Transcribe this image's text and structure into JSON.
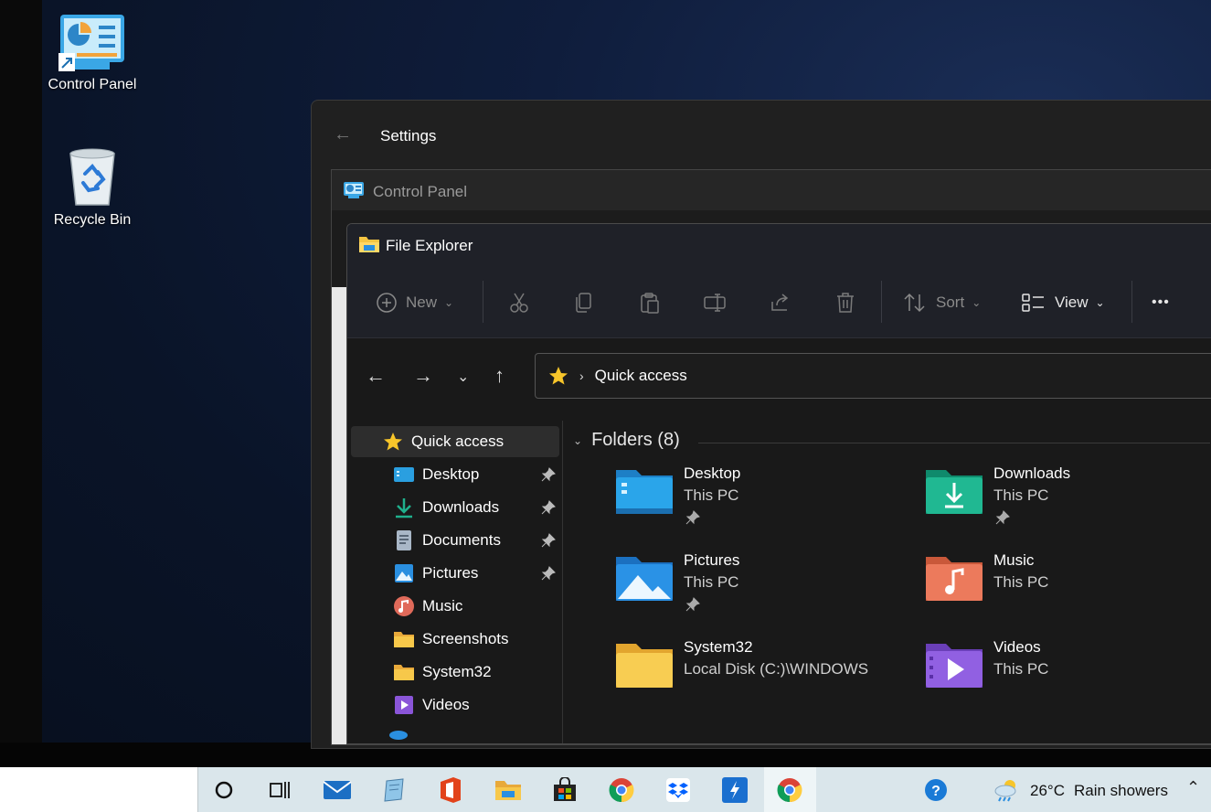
{
  "desktop": {
    "icons": [
      {
        "label": "Control Panel"
      },
      {
        "label": "Recycle Bin"
      }
    ]
  },
  "settings": {
    "title": "Settings"
  },
  "control_panel": {
    "title": "Control Panel"
  },
  "explorer": {
    "title": "File Explorer",
    "toolbar": {
      "new_label": "New",
      "sort_label": "Sort",
      "view_label": "View",
      "more_label": "•••"
    },
    "address": {
      "path": "Quick access"
    },
    "sidebar": {
      "items": [
        {
          "label": "Quick access",
          "icon": "star-icon",
          "pinned": false
        },
        {
          "label": "Desktop",
          "icon": "desktop-folder-icon",
          "pinned": true
        },
        {
          "label": "Downloads",
          "icon": "download-icon",
          "pinned": true
        },
        {
          "label": "Documents",
          "icon": "document-icon",
          "pinned": true
        },
        {
          "label": "Pictures",
          "icon": "pictures-icon",
          "pinned": true
        },
        {
          "label": "Music",
          "icon": "music-icon",
          "pinned": false
        },
        {
          "label": "Screenshots",
          "icon": "folder-icon",
          "pinned": false
        },
        {
          "label": "System32",
          "icon": "folder-icon",
          "pinned": false
        },
        {
          "label": "Videos",
          "icon": "videos-icon",
          "pinned": false
        }
      ]
    },
    "folders_header": "Folders (8)",
    "folders": [
      {
        "name": "Desktop",
        "location": "This PC",
        "pinned": true,
        "color": "#2a9fe0"
      },
      {
        "name": "Downloads",
        "location": "This PC",
        "pinned": true,
        "color": "#1fb08c"
      },
      {
        "name": "Pictures",
        "location": "This PC",
        "pinned": true,
        "color": "#2a8fe0"
      },
      {
        "name": "Music",
        "location": "This PC",
        "pinned": false,
        "color": "#e8765a"
      },
      {
        "name": "System32",
        "location": "Local Disk (C:)\\WINDOWS",
        "pinned": false,
        "color": "#f5c542"
      },
      {
        "name": "Videos",
        "location": "This PC",
        "pinned": false,
        "color": "#8a55d8"
      }
    ]
  },
  "taskbar": {
    "apps": [
      "search-icon",
      "task-view-icon",
      "mail-icon",
      "notes-icon",
      "office-icon",
      "file-explorer-icon",
      "store-icon",
      "chrome-icon",
      "dropbox-icon",
      "app-icon",
      "chrome-icon"
    ],
    "weather": {
      "temp": "26°C",
      "condition": "Rain showers"
    }
  }
}
